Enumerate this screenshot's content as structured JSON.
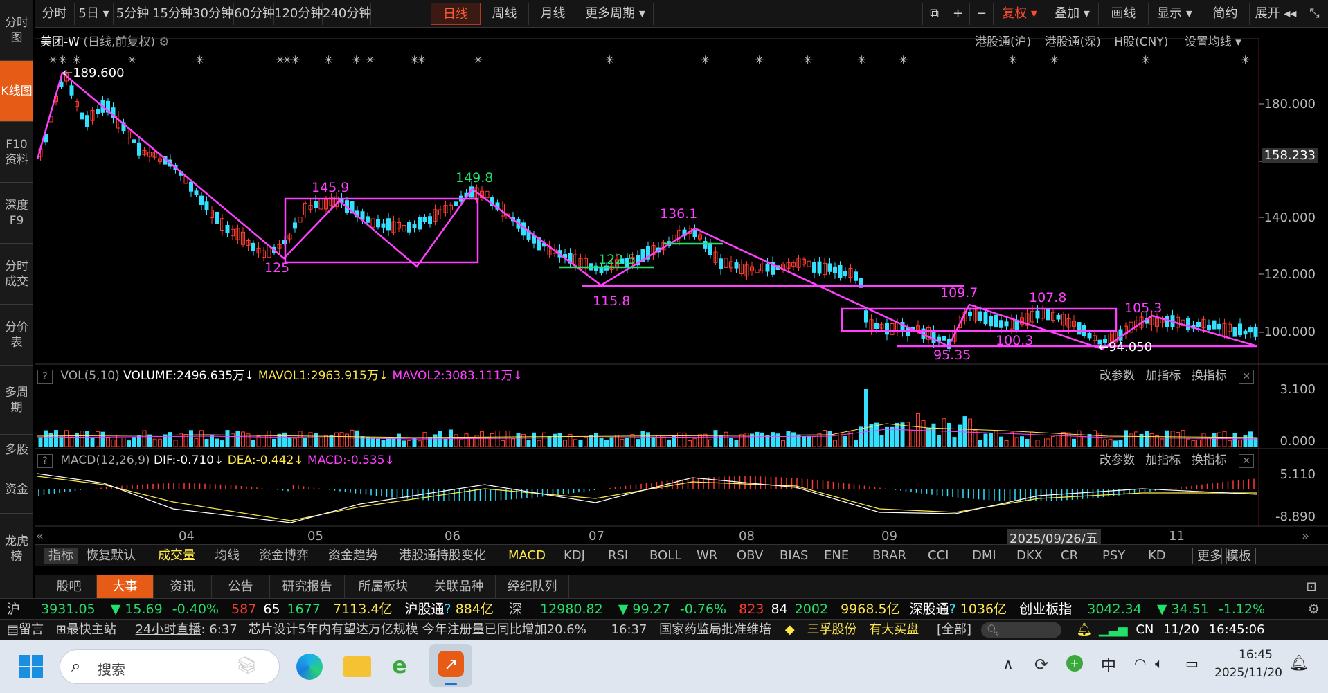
{
  "sidebar": [
    "分时图",
    "K线图",
    "F10资料",
    "深度F9",
    "分时成交",
    "分价表",
    "多周期",
    "多股",
    "资金",
    "龙虎榜"
  ],
  "periods": [
    "分时",
    "5日 ▾",
    "5分钟",
    "15分钟",
    "30分钟",
    "60分钟",
    "120分钟",
    "240分钟",
    "日线",
    "周线",
    "月线",
    "更多周期 ▾"
  ],
  "toolbar": {
    "fq": "复权 ▾",
    "overlay": "叠加 ▾",
    "draw": "画线",
    "display": "显示 ▾",
    "simple": "简约",
    "expand": "展开 ◂◂"
  },
  "stock": {
    "title": "美团-W",
    "sub": "(日线,前复权)",
    "links": [
      "港股通(沪)",
      "港股通(深)",
      "H股(CNY)",
      "设置均线 ▾"
    ]
  },
  "price_axis": [
    "180.000",
    "158.233",
    "140.000",
    "120.000",
    "100.000"
  ],
  "annotations": {
    "high": "←189.600",
    "a1": "145.9",
    "a2": "149.8",
    "a3": "125",
    "a4": "136.1",
    "a5": "122.5",
    "a6": "115.8",
    "a7": "109.7",
    "a8": "107.8",
    "a9": "105.3",
    "a10": "100.3",
    "a11": "95.35",
    "a12": "←94.050"
  },
  "vol": {
    "label": "VOL(5,10)",
    "volume": "VOLUME:2496.635万↓",
    "mavol1": "MAVOL1:2963.915万↓",
    "mavol2": "MAVOL2:3083.111万↓",
    "axis": [
      "3.100",
      "0.000"
    ],
    "actions": [
      "改参数",
      "加指标",
      "换指标"
    ]
  },
  "macd": {
    "label": "MACD(12,26,9)",
    "dif": "DIF:-0.710↓",
    "dea": "DEA:-0.442↓",
    "macd": "MACD:-0.535↓",
    "axis": [
      "5.110",
      "-8.890"
    ],
    "actions": [
      "改参数",
      "加指标",
      "换指标"
    ]
  },
  "xaxis": {
    "months": [
      "04",
      "05",
      "06",
      "07",
      "08",
      "09",
      "11"
    ],
    "cursor_date": "2025/09/26/五"
  },
  "indicators": [
    "指标",
    "恢复默认",
    "成交量",
    "均线",
    "资金博弈",
    "资金趋势",
    "港股通持股变化",
    "MACD",
    "KDJ",
    "RSI",
    "BOLL",
    "WR",
    "OBV",
    "BIAS",
    "ENE",
    "BRAR",
    "CCI",
    "DMI",
    "DKX",
    "CR",
    "PSY",
    "KD",
    "更多",
    "模板"
  ],
  "bottom_tabs": [
    "股吧",
    "大事",
    "资讯",
    "公告",
    "研究报告",
    "所属板块",
    "关联品种",
    "经纪队列"
  ],
  "ticker": {
    "sh_label": "沪",
    "sh": "3931.05",
    "sh_chg": "▼ 15.69",
    "sh_pct": "-0.40%",
    "sh_up": "587",
    "sh_flat": "65",
    "sh_dn": "1677",
    "sh_amt": "7113.4亿",
    "hgt_label": "沪股通",
    "hgt": "884亿",
    "sz_label": "深",
    "sz": "12980.82",
    "sz_chg": "▼ 99.27",
    "sz_pct": "-0.76%",
    "sz_up": "823",
    "sz_flat": "84",
    "sz_dn": "2002",
    "sz_amt": "9968.5亿",
    "sgt_label": "深股通",
    "sgt": "1036亿",
    "cyb_label": "创业板指",
    "cyb": "3042.34",
    "cyb_chg": "▼ 34.51",
    "cyb_pct": "-1.12%"
  },
  "news": {
    "msg": "留言",
    "home": "最快主站",
    "live": "24小时直播",
    "t1": "6:37",
    "n1": "芯片设计5年内有望达万亿规模 今年注册量已同比增加20.6%",
    "t2": "16:37",
    "n2": "国家药监局批准维培",
    "stock": "三孚股份",
    "stock_tag": "有大买盘",
    "all": "[全部]",
    "cn": "CN",
    "date": "11/20",
    "time": "16:45:06"
  },
  "taskbar": {
    "search": "搜索",
    "ime": "中",
    "clock": "16:45",
    "date": "2025/11/20"
  }
}
